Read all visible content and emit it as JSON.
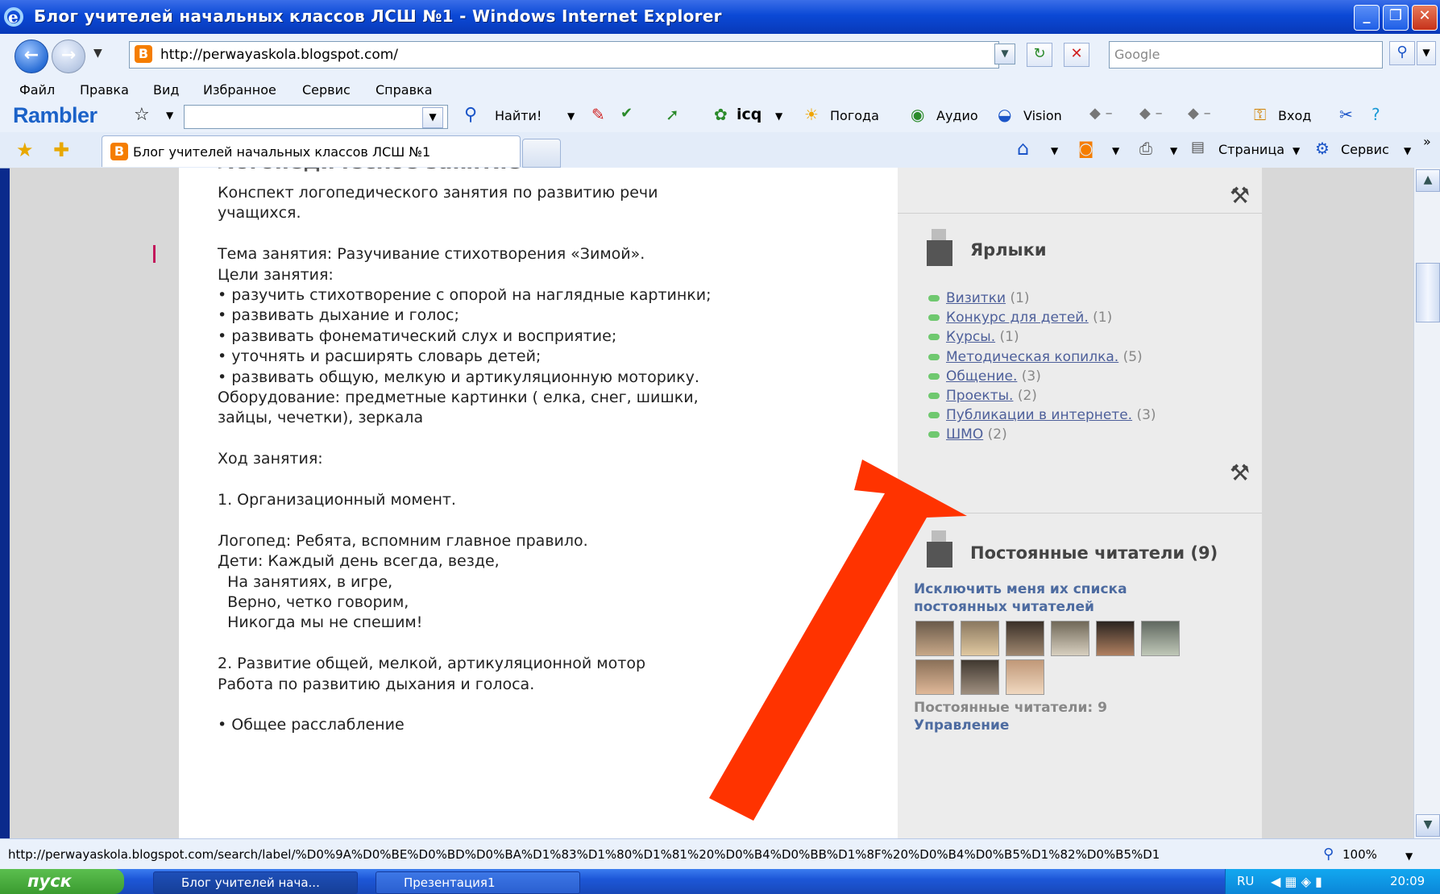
{
  "window": {
    "title": "Блог учителей начальных классов ЛСШ №1 - Windows Internet Explorer"
  },
  "address_bar": {
    "url": "http://perwayaskola.blogspot.com/",
    "search_placeholder": "Google"
  },
  "menu": [
    "Файл",
    "Правка",
    "Вид",
    "Избранное",
    "Сервис",
    "Справка"
  ],
  "rambler": {
    "logo": "Rambler",
    "find_label": "Найти!",
    "icq_label": "icq",
    "weather_label": "Погода",
    "audio_label": "Аудио",
    "vision_label": "Vision",
    "login_label": "Вход"
  },
  "tab": {
    "title": "Блог учителей начальных классов ЛСШ №1"
  },
  "command_bar": {
    "page_label": "Страница",
    "service_label": "Сервис"
  },
  "post": {
    "heading": "Логопедическое занятие",
    "lines": [
      "Конспект логопедического занятия по развитию речи",
      "учащихся.",
      "",
      "Тема занятия: Разучивание стихотворения «Зимой».",
      "Цели занятия:",
      "• разучить стихотворение с опорой на наглядные картинки;",
      "• развивать дыхание и голос;",
      "• развивать фонематический слух и восприятие;",
      "• уточнять и расширять словарь детей;",
      "• развивать общую, мелкую и артикуляционную моторику.",
      "Оборудование: предметные картинки ( елка, снег, шишки,",
      "зайцы, чечетки), зеркала",
      "",
      "Ход занятия:",
      "",
      "1. Организационный момент.",
      "",
      "Логопед: Ребята, вспомним главное правило.",
      "Дети: Каждый день всегда, везде,",
      "  На занятиях, в игре,",
      "  Верно, четко говорим,",
      "  Никогда мы не спешим!",
      "",
      "2. Развитие общей, мелкой, артикуляционной мотор",
      "Работа по развитию дыхания и голоса.",
      "",
      "• Общее расслабление"
    ]
  },
  "sidebar": {
    "labels_title": "Ярлыки",
    "labels": [
      {
        "name": "Визитки",
        "count": "(1)"
      },
      {
        "name": "Конкурс для детей.",
        "count": "(1)"
      },
      {
        "name": "Курсы.",
        "count": "(1)"
      },
      {
        "name": "Методическая копилка.",
        "count": "(5)"
      },
      {
        "name": "Общение.",
        "count": "(3)"
      },
      {
        "name": "Проекты.",
        "count": "(2)"
      },
      {
        "name": "Публикации в интернете.",
        "count": "(3)"
      },
      {
        "name": "ШМО",
        "count": "(2)"
      }
    ],
    "followers_title": "Постоянные читатели (9)",
    "leave_link_line1": "Исключить меня их списка",
    "leave_link_line2": "постоянных читателей",
    "followers_count": "Постоянные читатели: 9",
    "manage_link": "Управление"
  },
  "status_bar": {
    "url": "http://perwayaskola.blogspot.com/search/label/%D0%9A%D0%BE%D0%BD%D0%BA%D1%83%D1%80%D1%81%20%D0%B4%D0%BB%D1%8F%20%D0%B4%D0%B5%D1%82%D0%B5%D1",
    "zoom": "100%"
  },
  "taskbar": {
    "start_label": "пуск",
    "buttons": [
      "Блог учителей нача...",
      "Презентация1"
    ],
    "lang": "RU",
    "clock": "20:09"
  },
  "colors": {
    "title_bar": "#0b49d6",
    "arrow": "#ff3300",
    "label_bullet": "#6fc86f",
    "link": "#4d5f9a"
  }
}
